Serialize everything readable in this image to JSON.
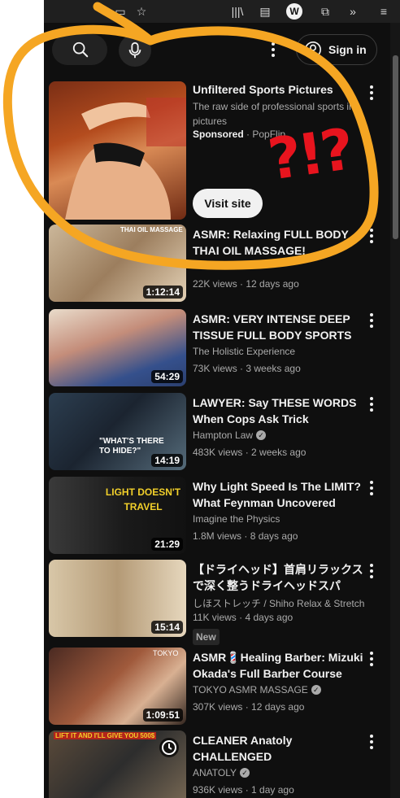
{
  "browser": {
    "icons": [
      "library-icon",
      "reader-view-icon",
      "w-extension-icon",
      "puzzle-extensions-icon",
      "chevron-more-icon",
      "menu-icon"
    ],
    "w_label": "W"
  },
  "header": {
    "sign_in_label": "Sign in"
  },
  "ad": {
    "title": "Unfiltered Sports Pictures",
    "description": "The raw side of professional sports in pictures",
    "sponsored_label": "Sponsored",
    "advertiser": "PopFlip",
    "button_label": "Visit site"
  },
  "videos": [
    {
      "title": "ASMR: Relaxing FULL BODY THAI OIL MASSAGE!",
      "channel": "",
      "views": "22K views",
      "age": "12 days ago",
      "duration": "1:12:14",
      "verified": false,
      "badge": "",
      "thumb_text": "THAI OIL MASSAGE"
    },
    {
      "title": "ASMR: VERY INTENSE DEEP TISSUE FULL BODY SPORTS ...",
      "channel": "The Holistic Experience",
      "views": "73K views",
      "age": "3 weeks ago",
      "duration": "54:29",
      "verified": false,
      "badge": "",
      "thumb_text": ""
    },
    {
      "title": "LAWYER: Say THESE WORDS When Cops Ask Trick Questions",
      "channel": "Hampton Law",
      "views": "483K views",
      "age": "2 weeks ago",
      "duration": "14:19",
      "verified": true,
      "badge": "",
      "thumb_text": "\"WHAT'S THERE TO HIDE?\""
    },
    {
      "title": "Why Light Speed Is The LIMIT? What Feynman Uncovered Will...",
      "channel": "Imagine the Physics",
      "views": "1.8M views",
      "age": "8 days ago",
      "duration": "21:29",
      "verified": false,
      "badge": "",
      "thumb_text": "LIGHT DOESN'T TRAVEL"
    },
    {
      "title": "【ドライヘッド】首肩リラックスで深く整うドライヘッドスパ",
      "channel": "しほストレッチ / Shiho Relax & Stretch",
      "views": "11K views",
      "age": "4 days ago",
      "duration": "15:14",
      "verified": false,
      "badge": "New",
      "thumb_text": ""
    },
    {
      "title": "ASMR💈Healing Barber: Mizuki Okada's Full Barber Course",
      "channel": "TOKYO ASMR MASSAGE",
      "views": "307K views",
      "age": "12 days ago",
      "duration": "1:09:51",
      "verified": true,
      "badge": "",
      "thumb_text": "TOKYO"
    },
    {
      "title": "CLEANER Anatoly CHALLENGED BODYBUILDERS...",
      "channel": "ANATOLY",
      "views": "936K views",
      "age": "1 day ago",
      "duration": "",
      "verified": true,
      "badge": "",
      "thumb_text": "LIFT IT AND I'LL GIVE YOU 500$"
    }
  ],
  "annotation": {
    "text": "?!?",
    "circle_color": "#f5a623",
    "text_color": "#e8141e"
  }
}
